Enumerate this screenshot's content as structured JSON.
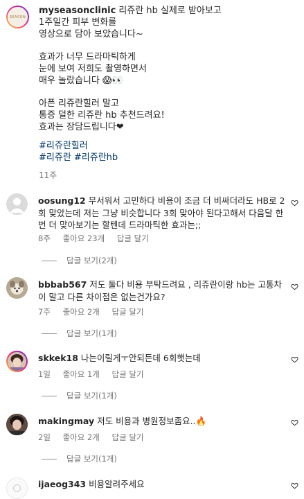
{
  "caption": {
    "avatar_text": "SEASON",
    "username": "myseasonclinic",
    "body": "리쥬란 hb 실제로 받아보고\n1주일간 피부 변화를\n영상으로 담아 보았습니다~\n\n효과가 너무 드라마틱하게\n눈에 보여 저희도 촬영하면서\n매우 놀랐습니다 😱👀\n\n아픈 리쥬란힐러 말고\n통증 덜한 리쥬란 hb 추천드려요!\n효과는 장담드립니다❤",
    "hashtags": [
      "#리쥬란힐러",
      "#리쥬란 #리쥬란hb"
    ],
    "time": "11주"
  },
  "comments": [
    {
      "username": "oosung12",
      "text": "무서워서 고민하다 비용이 조금 더 비싸더라도 HB로 2회 맞았는데 저는 그냥 비슷합니다 3회 맞아야 된다고해서 다음달 한 번 더 맞아보기는 할텐데 드라마틱한 효과는;;",
      "time": "8주",
      "likes": "좋아요 23개",
      "reply": "답글 달기",
      "view_replies": "답글 보기(2개)"
    },
    {
      "username": "bbbab567",
      "text": "저도 둘다 비용 부탁드려요 , 리쥬란이랑 hb는 고통차이 말고 다른 차이점은 없는건가요?",
      "time": "7주",
      "likes": "좋아요 2개",
      "reply": "답글 달기",
      "view_replies": "답글 보기(1개)"
    },
    {
      "username": "skkek18",
      "text": "나는이릴게ㅜ안되든데 6회햇는데",
      "time": "1일",
      "likes": "좋아요 1개",
      "reply": "답글 달기",
      "view_replies": "답글 보기(1개)"
    },
    {
      "username": "makingmay",
      "text": "저도 비용과 병원정보좀요..🔥",
      "time": "2일",
      "likes": "좋아요 2개",
      "reply": "답글 달기",
      "view_replies": "답글 보기(1개)"
    },
    {
      "username": "ijaeog343",
      "text": "비용알려주세요"
    }
  ],
  "icons": {
    "like": "heart-outline-icon"
  }
}
